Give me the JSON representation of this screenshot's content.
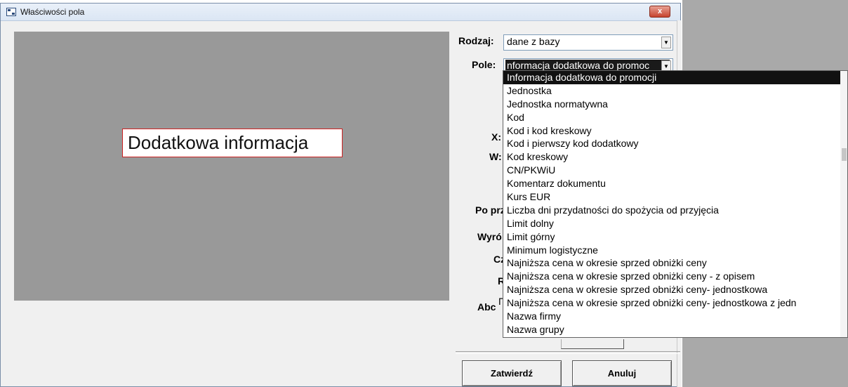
{
  "window": {
    "title": "Właściwości pola",
    "close_label": "x"
  },
  "preview": {
    "label_text": "Dodatkowa informacja"
  },
  "form": {
    "rodzaj": {
      "label": "Rodzaj:",
      "value": "dane z bazy"
    },
    "pole": {
      "label": "Pole:",
      "value": "nformacja dodatkowa do promoc"
    },
    "x_label": "X:",
    "w_label": "W:",
    "po_prz_label": "Po prz",
    "wyro_label": "Wyró",
    "cz_label": "Cz",
    "r_label": "R",
    "abc_label": "Abc",
    "abc_check": "Γ"
  },
  "dropdown": {
    "items": [
      "Informacja dodatkowa do promocji",
      "Jednostka",
      "Jednostka normatywna",
      "Kod",
      "Kod i kod kreskowy",
      "Kod i pierwszy kod dodatkowy",
      "Kod kreskowy",
      "CN/PKWiU",
      "Komentarz dokumentu",
      "Kurs EUR",
      "Liczba dni przydatności do spożycia od przyjęcia",
      "Limit dolny",
      "Limit górny",
      "Minimum logistyczne",
      "Najniższa cena w okresie sprzed obniżki ceny",
      "Najniższa cena w okresie sprzed obniżki ceny - z opisem",
      "Najniższa cena w okresie sprzed obniżki ceny- jednostkowa",
      "Najniższa cena w okresie sprzed obniżki ceny- jednostkowa z jedn",
      "Nazwa firmy",
      "Nazwa grupy"
    ],
    "selected_index": 0
  },
  "buttons": {
    "confirm": "Zatwierdź",
    "cancel": "Anuluj"
  },
  "colors": {
    "preview_bg": "#999999",
    "selection": "#111111",
    "label_border": "#cc2222"
  }
}
